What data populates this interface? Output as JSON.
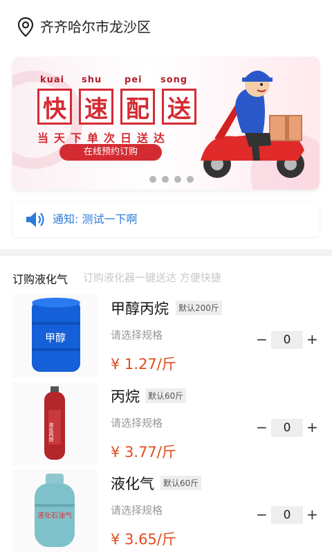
{
  "header": {
    "location": "齐齐哈尔市龙沙区"
  },
  "banner": {
    "pinyin": [
      "kuai",
      "shu",
      "pei",
      "song"
    ],
    "title_chars": [
      "快",
      "速",
      "配",
      "送"
    ],
    "subtitle": "当天下单次日送达",
    "order_button": "在线预约订购",
    "thumb_label": "甲醇",
    "dots": 4
  },
  "notice": {
    "text": "通知: 测试一下啊"
  },
  "section": {
    "title": "订购液化气",
    "subtitle": "订购液化器一键送达 方便快捷"
  },
  "products": [
    {
      "name": "甲醇丙烷",
      "tag": "默认200斤",
      "spec": "请选择规格",
      "price": "¥ 1.27/斤",
      "qty": "0",
      "minus": "−",
      "plus": "+",
      "icon": "blue-drum",
      "label": "甲醇"
    },
    {
      "name": "丙烷",
      "tag": "默认60斤",
      "spec": "请选择规格",
      "price": "¥ 3.77/斤",
      "qty": "0",
      "minus": "−",
      "plus": "+",
      "icon": "red-cylinder",
      "label": "液化丙烷"
    },
    {
      "name": "液化气",
      "tag": "默认60斤",
      "spec": "请选择规格",
      "price": "¥ 3.65/斤",
      "qty": "0",
      "minus": "−",
      "plus": "+",
      "icon": "gas-tank",
      "label": "液化石油气"
    }
  ],
  "colors": {
    "accent_red": "#d42b33",
    "price": "#e24a1e",
    "notice_blue": "#2c7bd9"
  }
}
